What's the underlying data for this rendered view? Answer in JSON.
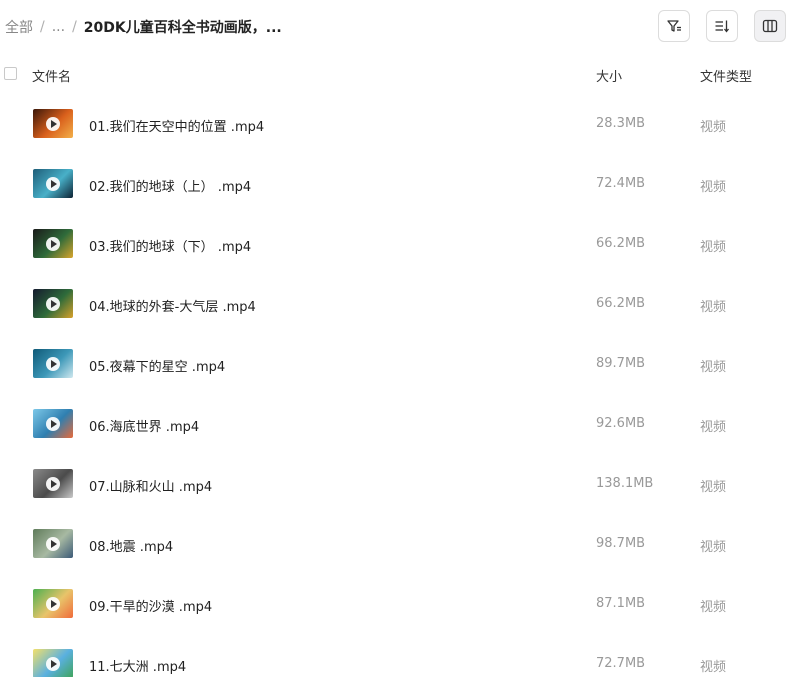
{
  "breadcrumb": {
    "root": "全部",
    "ellipsis": "...",
    "current": "20DK儿童百科全书动画版，..."
  },
  "toolbar": {
    "filter_icon": "filter-icon",
    "sort_icon": "sort-icon",
    "view_icon": "column-view-icon"
  },
  "columns": {
    "name": "文件名",
    "size": "大小",
    "type": "文件类型"
  },
  "files": [
    {
      "name": "01.我们在天空中的位置 .mp4",
      "size": "28.3MB",
      "type": "视频",
      "thumb": [
        "#3a1608",
        "#d9601c",
        "#f3b04a"
      ]
    },
    {
      "name": "02.我们的地球（上） .mp4",
      "size": "72.4MB",
      "type": "视频",
      "thumb": [
        "#1e5d78",
        "#48b0c8",
        "#0d2233"
      ]
    },
    {
      "name": "03.我们的地球（下） .mp4",
      "size": "66.2MB",
      "type": "视频",
      "thumb": [
        "#1a1a1a",
        "#2f6b3a",
        "#d9a52c"
      ]
    },
    {
      "name": "04.地球的外套-大气层 .mp4",
      "size": "66.2MB",
      "type": "视频",
      "thumb": [
        "#151a2e",
        "#2e6b3a",
        "#d8a12a"
      ]
    },
    {
      "name": "05.夜幕下的星空 .mp4",
      "size": "89.7MB",
      "type": "视频",
      "thumb": [
        "#0f5a78",
        "#3d98b8",
        "#cfe8ef"
      ]
    },
    {
      "name": "06.海底世界 .mp4",
      "size": "92.6MB",
      "type": "视频",
      "thumb": [
        "#7cc8e8",
        "#2f7fb0",
        "#e86a3a"
      ]
    },
    {
      "name": "07.山脉和火山 .mp4",
      "size": "138.1MB",
      "type": "视频",
      "thumb": [
        "#8a8a8a",
        "#4b4b4b",
        "#c9c9c9"
      ]
    },
    {
      "name": "08.地震 .mp4",
      "size": "98.7MB",
      "type": "视频",
      "thumb": [
        "#5f7b5a",
        "#a7b9a2",
        "#3c5a77"
      ]
    },
    {
      "name": "09.干旱的沙漠 .mp4",
      "size": "87.1MB",
      "type": "视频",
      "thumb": [
        "#4caf50",
        "#e8c46a",
        "#f06b3a"
      ]
    },
    {
      "name": "11.七大洲 .mp4",
      "size": "72.7MB",
      "type": "视频",
      "thumb": [
        "#f3e06a",
        "#5ab0e0",
        "#3fa45a"
      ]
    }
  ]
}
